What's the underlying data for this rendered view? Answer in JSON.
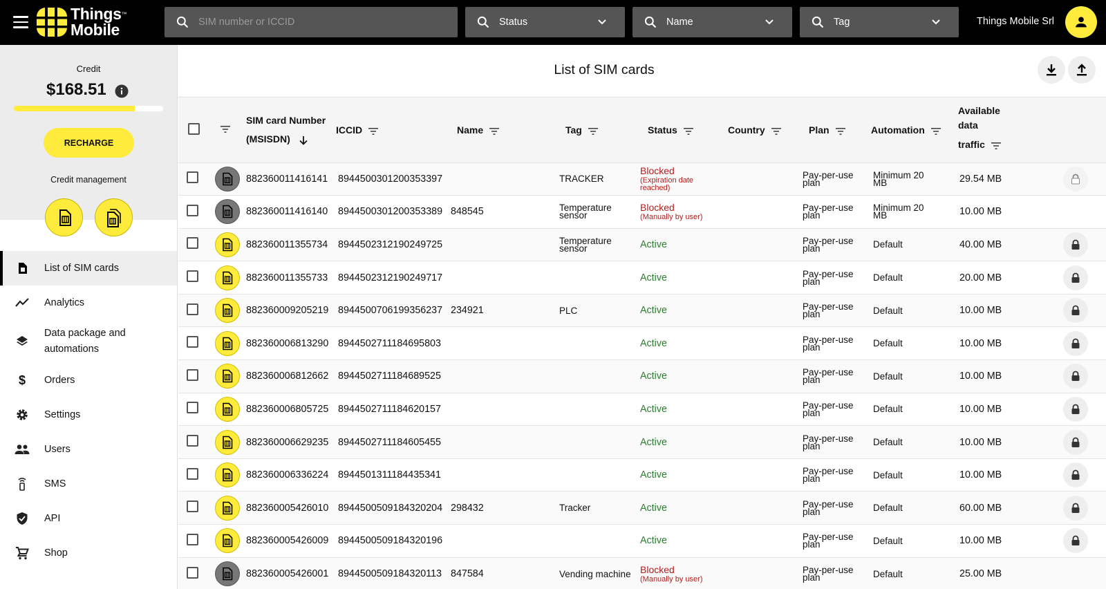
{
  "app": {
    "logo_line1": "Things",
    "logo_line2": "Mobile",
    "logo_tm": "™",
    "company": "Things Mobile Srl",
    "accent": "#ffeb3b"
  },
  "search": {
    "sim_placeholder": "SIM number or ICCID",
    "status_label": "Status",
    "name_label": "Name",
    "tag_label": "Tag"
  },
  "sidebar": {
    "credit_label": "Credit",
    "credit_amount": "$168.51",
    "credit_level_pct": 81,
    "recharge_label": "RECHARGE",
    "credit_management_label": "Credit management",
    "nav": [
      {
        "label": "List of SIM cards",
        "icon": "sim-card-icon",
        "active": true
      },
      {
        "label": "Analytics",
        "icon": "trend-line-icon"
      },
      {
        "label": "Data package and automations",
        "icon": "layers-icon"
      },
      {
        "label": "Orders",
        "icon": "dollar-icon"
      },
      {
        "label": "Settings",
        "icon": "gear-icon"
      },
      {
        "label": "Users",
        "icon": "users-icon"
      },
      {
        "label": "SMS",
        "icon": "antenna-icon"
      },
      {
        "label": "API",
        "icon": "shield-icon"
      },
      {
        "label": "Shop",
        "icon": "cart-icon"
      }
    ]
  },
  "main": {
    "title": "List of SIM cards",
    "columns": {
      "msisdn_line1": "SIM card Number",
      "msisdn_line2": "(MSISDN)",
      "iccid": "ICCID",
      "name": "Name",
      "tag": "Tag",
      "status": "Status",
      "country": "Country",
      "plan": "Plan",
      "automation": "Automation",
      "traffic_line1": "Available",
      "traffic_line2": "data",
      "traffic_line3": "traffic"
    },
    "rows": [
      {
        "state": "blocked",
        "msisdn": "882360011416141",
        "iccid": "8944500301200353397",
        "name": "",
        "tag": "TRACKER",
        "status": "Blocked",
        "reason": "(Expiration date reached)",
        "plan": "Pay-per-use plan",
        "automation": "Minimum 20 MB",
        "traffic": "29.54 MB",
        "lock": "off"
      },
      {
        "state": "blocked",
        "msisdn": "882360011416140",
        "iccid": "8944500301200353389",
        "name": "848545",
        "tag": "Temperature sensor",
        "status": "Blocked",
        "reason": "(Manually by user)",
        "plan": "Pay-per-use plan",
        "automation": "Minimum 20 MB",
        "traffic": "10.00 MB",
        "lock": "none"
      },
      {
        "state": "active",
        "msisdn": "882360011355734",
        "iccid": "8944502312190249725",
        "name": "",
        "tag": "Temperature sensor",
        "status": "Active",
        "reason": "",
        "plan": "Pay-per-use plan",
        "automation": "Default",
        "traffic": "40.00 MB",
        "lock": "on"
      },
      {
        "state": "active",
        "msisdn": "882360011355733",
        "iccid": "8944502312190249717",
        "name": "",
        "tag": "",
        "status": "Active",
        "reason": "",
        "plan": "Pay-per-use plan",
        "automation": "Default",
        "traffic": "20.00 MB",
        "lock": "on"
      },
      {
        "state": "active",
        "msisdn": "882360009205219",
        "iccid": "8944500706199356237",
        "name": "234921",
        "tag": "PLC",
        "status": "Active",
        "reason": "",
        "plan": "Pay-per-use plan",
        "automation": "Default",
        "traffic": "10.00 MB",
        "lock": "on"
      },
      {
        "state": "active",
        "msisdn": "882360006813290",
        "iccid": "8944502711184695803",
        "name": "",
        "tag": "",
        "status": "Active",
        "reason": "",
        "plan": "Pay-per-use plan",
        "automation": "Default",
        "traffic": "10.00 MB",
        "lock": "on"
      },
      {
        "state": "active",
        "msisdn": "882360006812662",
        "iccid": "8944502711184689525",
        "name": "",
        "tag": "",
        "status": "Active",
        "reason": "",
        "plan": "Pay-per-use plan",
        "automation": "Default",
        "traffic": "10.00 MB",
        "lock": "on"
      },
      {
        "state": "active",
        "msisdn": "882360006805725",
        "iccid": "8944502711184620157",
        "name": "",
        "tag": "",
        "status": "Active",
        "reason": "",
        "plan": "Pay-per-use plan",
        "automation": "Default",
        "traffic": "10.00 MB",
        "lock": "on"
      },
      {
        "state": "active",
        "msisdn": "882360006629235",
        "iccid": "8944502711184605455",
        "name": "",
        "tag": "",
        "status": "Active",
        "reason": "",
        "plan": "Pay-per-use plan",
        "automation": "Default",
        "traffic": "10.00 MB",
        "lock": "on"
      },
      {
        "state": "active",
        "msisdn": "882360006336224",
        "iccid": "8944501311184435341",
        "name": "",
        "tag": "",
        "status": "Active",
        "reason": "",
        "plan": "Pay-per-use plan",
        "automation": "Default",
        "traffic": "10.00 MB",
        "lock": "on"
      },
      {
        "state": "active",
        "msisdn": "882360005426010",
        "iccid": "8944500509184320204",
        "name": "298432",
        "tag": "Tracker",
        "status": "Active",
        "reason": "",
        "plan": "Pay-per-use plan",
        "automation": "Default",
        "traffic": "60.00 MB",
        "lock": "on"
      },
      {
        "state": "active",
        "msisdn": "882360005426009",
        "iccid": "8944500509184320196",
        "name": "",
        "tag": "",
        "status": "Active",
        "reason": "",
        "plan": "Pay-per-use plan",
        "automation": "Default",
        "traffic": "10.00 MB",
        "lock": "on"
      },
      {
        "state": "blocked",
        "msisdn": "882360005426001",
        "iccid": "8944500509184320113",
        "name": "847584",
        "tag": "Vending machine",
        "status": "Blocked",
        "reason": "(Manually by user)",
        "plan": "Pay-per-use plan",
        "automation": "Default",
        "traffic": "25.00 MB",
        "lock": "none"
      }
    ]
  }
}
